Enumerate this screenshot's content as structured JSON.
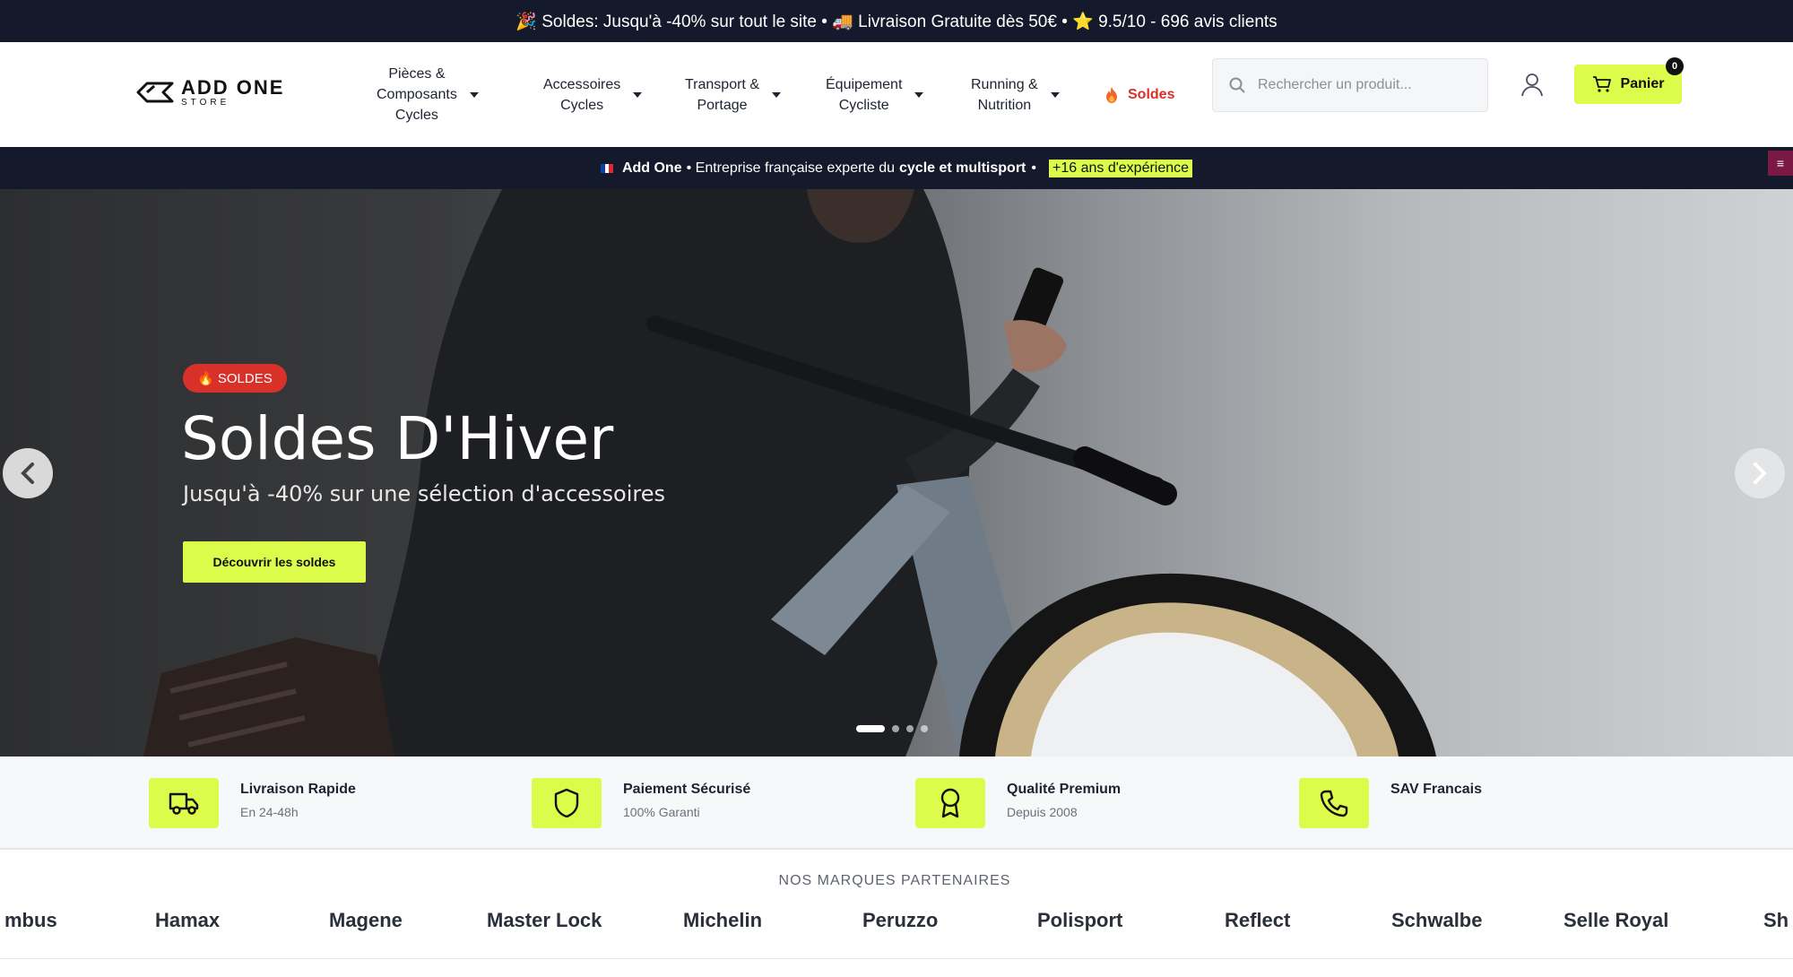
{
  "topbar": {
    "text": "🎉 Soldes: Jusqu'à -40% sur tout le site • 🚚 Livraison Gratuite dès 50€ • ⭐ 9.5/10 - 696 avis clients"
  },
  "header": {
    "logo": {
      "main": "ADD ONE",
      "sub": "STORE"
    },
    "nav": [
      {
        "label": "Pièces & Composants Cycles",
        "line1": "Pièces &",
        "line2": "Composants",
        "line3": "Cycles"
      },
      {
        "label": "Accessoires Cycles",
        "line1": "Accessoires",
        "line2": "Cycles"
      },
      {
        "label": "Transport & Portage",
        "line1": "Transport &",
        "line2": "Portage"
      },
      {
        "label": "Équipement Cycliste",
        "line1": "Équipement",
        "line2": "Cycliste"
      },
      {
        "label": "Running & Nutrition",
        "line1": "Running &",
        "line2": "Nutrition"
      },
      {
        "label": "Soldes",
        "icon": "fire-icon"
      }
    ],
    "search": {
      "placeholder": "Rechercher un produit...",
      "value": ""
    },
    "cart": {
      "label": "Panier",
      "count": "0"
    }
  },
  "infobar": {
    "brand": "Add One",
    "text1": "• Entreprise française experte du",
    "bold": "cycle et multisport",
    "sep": "•",
    "highlight": "+16 ans d'expérience"
  },
  "hero": {
    "badge": "🔥 SOLDES",
    "title": "Soldes D'Hiver",
    "subtitle": "Jusqu'à -40% sur une sélection d'accessoires",
    "cta": "Découvrir les soldes",
    "slides_total": 4,
    "slide_active": 1
  },
  "features": [
    {
      "title": "Livraison Rapide",
      "subtitle": "En 24-48h",
      "icon": "truck-icon"
    },
    {
      "title": "Paiement Sécurisé",
      "subtitle": "100% Garanti",
      "icon": "shield-icon"
    },
    {
      "title": "Qualité Premium",
      "subtitle": "Depuis 2008",
      "icon": "award-icon"
    },
    {
      "title": "SAV Francais",
      "subtitle": "",
      "icon": "phone-icon"
    }
  ],
  "brands": {
    "title": "NOS MARQUES PARTENAIRES",
    "items": [
      "mbus",
      "Hamax",
      "Magene",
      "Master Lock",
      "Michelin",
      "Peruzzo",
      "Polisport",
      "Reflect",
      "Schwalbe",
      "Selle Royal",
      "Sh"
    ]
  },
  "colors": {
    "accent": "#dcfb4b",
    "dark": "#141a2c",
    "sale": "#d8312a"
  }
}
